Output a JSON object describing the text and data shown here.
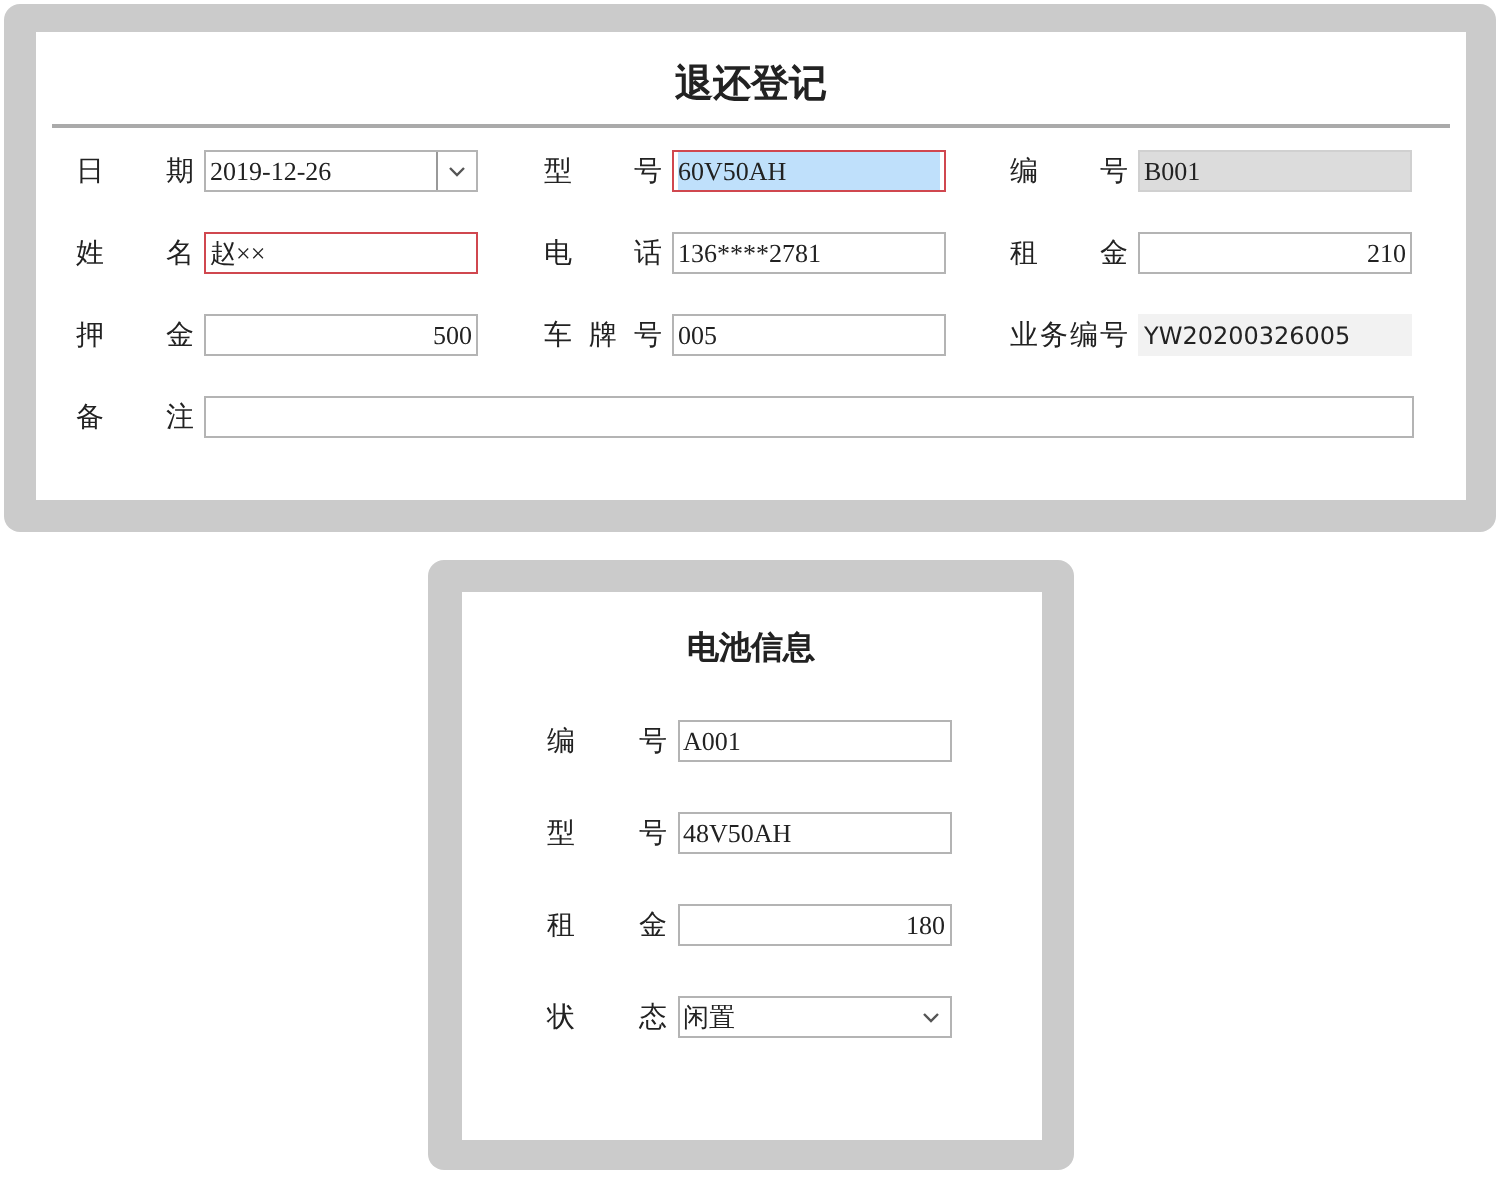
{
  "return_form": {
    "title": "退还登记",
    "fields": [
      {
        "label": "日 期",
        "kind": "date",
        "value": "2019-12-26",
        "invalid": false,
        "selected": false
      },
      {
        "label": "型 号",
        "kind": "text",
        "value": "60V50AH",
        "invalid": true,
        "selected": true
      },
      {
        "label": "编 号",
        "kind": "readonly",
        "value": "B001",
        "invalid": false,
        "selected": false
      },
      {
        "label": "姓 名",
        "kind": "text",
        "value": "赵××",
        "invalid": true,
        "selected": false
      },
      {
        "label": "电 话",
        "kind": "text",
        "value": "136****2781",
        "invalid": false,
        "selected": false
      },
      {
        "label": "租 金",
        "kind": "number",
        "value": "210",
        "invalid": false,
        "selected": false
      },
      {
        "label": "押 金",
        "kind": "number",
        "value": "500",
        "invalid": false,
        "selected": false
      },
      {
        "label": "车 牌 号",
        "kind": "text",
        "value": "005",
        "invalid": false,
        "selected": false
      },
      {
        "label": "业务编号",
        "kind": "display",
        "value": "YW20200326005",
        "invalid": false,
        "selected": false
      },
      {
        "label": "备 注",
        "kind": "wide",
        "invalid": false,
        "selected": false
      }
    ]
  },
  "battery_info": {
    "title": "电池信息",
    "fields": [
      {
        "label": "编 号",
        "kind": "text",
        "value": "A001",
        "invalid": false,
        "selected": false
      },
      {
        "label": "型 号",
        "kind": "text",
        "value": "48V50AH",
        "invalid": false,
        "selected": false
      },
      {
        "label": "租 金",
        "kind": "number",
        "value": "180",
        "invalid": false,
        "selected": false
      },
      {
        "label": "状 态",
        "kind": "select",
        "value": "闲置",
        "invalid": false,
        "selected": false
      }
    ]
  }
}
